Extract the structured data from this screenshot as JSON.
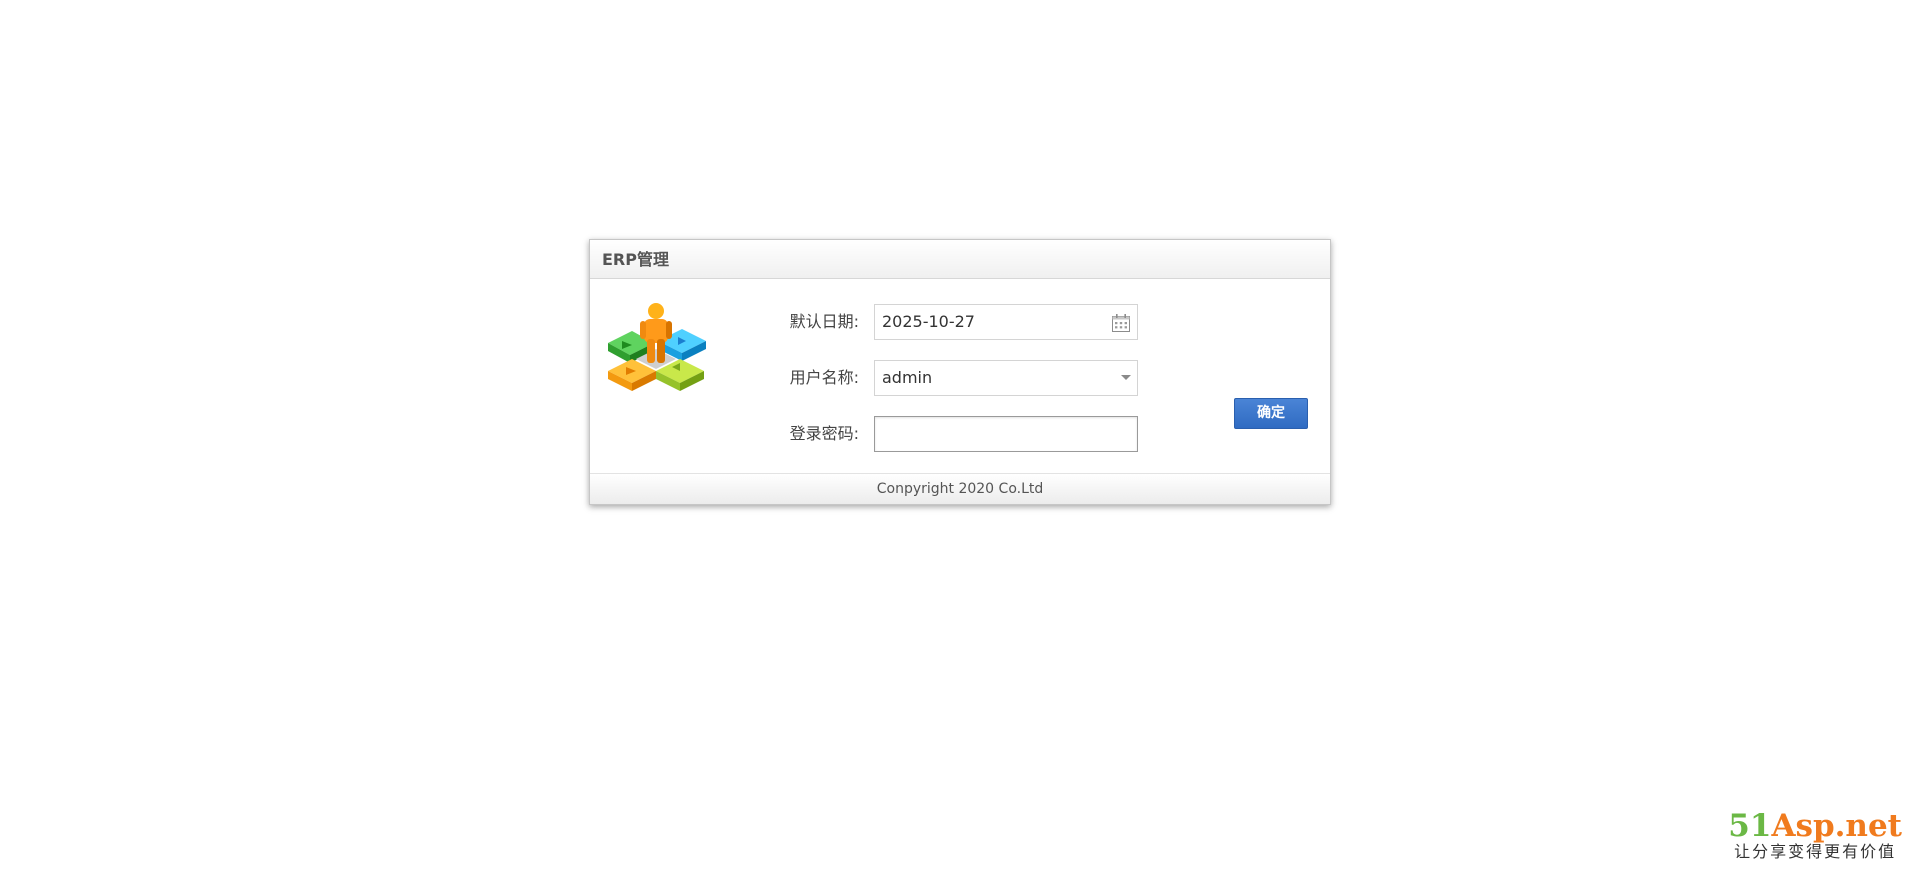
{
  "window": {
    "title": "ERP管理"
  },
  "form": {
    "date": {
      "label": "默认日期:",
      "value": "2025-10-27"
    },
    "username": {
      "label": "用户名称:",
      "value": "admin"
    },
    "password": {
      "label": "登录密码:",
      "value": ""
    }
  },
  "actions": {
    "confirm_label": "确定"
  },
  "footer": {
    "copyright": "Conpyright 2020 Co.Ltd"
  },
  "watermark": {
    "brand_prefix": "51",
    "brand_suffix": "Asp.net",
    "slogan": "让分享变得更有价值"
  },
  "icons": {
    "calendar": "calendar-icon",
    "dropdown": "chevron-down-icon",
    "logo": "erp-logo"
  },
  "colors": {
    "button": "#3a76cc",
    "brand_green": "#6bb845",
    "brand_orange": "#f07b1e"
  }
}
